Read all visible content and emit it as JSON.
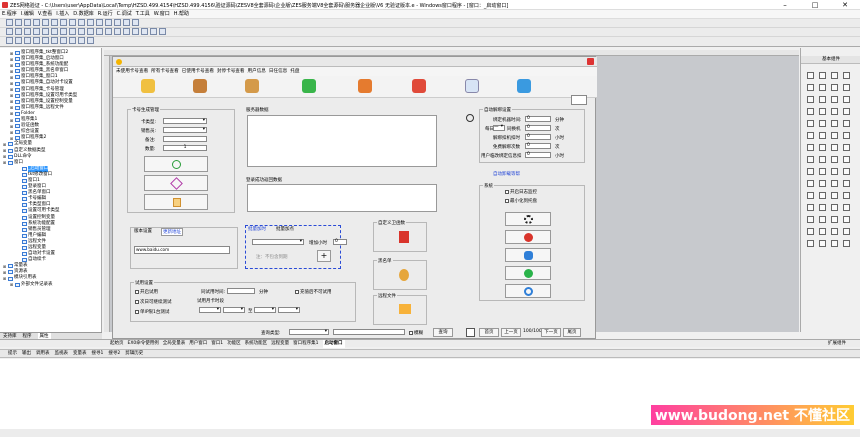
{
  "window": {
    "title": "ZES网络验证 - C:\\Users\\user\\AppData\\Local\\Temp\\HZSD.499.4154\\HZSD.499.4156\\验证源码\\ZESV8全套源码\\企业版\\ZES服务端V8全套源码\\服务器企业版\\V6 无验证版本.e - Windows窗口程序 - [窗口：_启动窗口]",
    "minimize": "–",
    "maximize": "□",
    "close": "✕"
  },
  "menubar": [
    "E.程序",
    "I.编辑",
    "V.查看",
    "I.插入",
    "D.数据库",
    "R.运行",
    "C.调试",
    "T.工具",
    "W.窗口",
    "H.帮助"
  ],
  "tree": {
    "items": [
      {
        "label": "窗口程序集_tkt整窗口2",
        "depth": 1,
        "icon": true
      },
      {
        "label": "窗口程序集_启动窗口",
        "depth": 1,
        "icon": true
      },
      {
        "label": "窗口程序集_系统功能配",
        "depth": 1,
        "icon": true
      },
      {
        "label": "窗口程序集_黑名单窗口",
        "depth": 1,
        "icon": true
      },
      {
        "label": "窗口程序集_窗口1",
        "depth": 1,
        "icon": true
      },
      {
        "label": "窗口程序集_自动对卡设置",
        "depth": 1,
        "icon": true
      },
      {
        "label": "窗口程序集_卡号管理",
        "depth": 1,
        "icon": true
      },
      {
        "label": "窗口程序集_设置可用卡类型",
        "depth": 1,
        "icon": true
      },
      {
        "label": "窗口程序集_设置控制变量",
        "depth": 1,
        "icon": true
      },
      {
        "label": "窗口程序集_远程文件",
        "depth": 1,
        "icon": true
      },
      {
        "label": "Folder",
        "depth": 1,
        "icon": true
      },
      {
        "label": "程序集1",
        "depth": 1,
        "icon": true
      },
      {
        "label": "验证函数",
        "depth": 1,
        "icon": true
      },
      {
        "label": "综合设置",
        "depth": 1,
        "icon": true
      },
      {
        "label": "窗口程序集2",
        "depth": 1,
        "icon": true
      },
      {
        "label": "全局变量",
        "depth": 0,
        "icon": true
      },
      {
        "label": "自定义数据类型",
        "depth": 0,
        "icon": true
      },
      {
        "label": "DLL命令",
        "depth": 0,
        "icon": true
      },
      {
        "label": "窗口",
        "depth": 0,
        "icon": true
      },
      {
        "label": "_启动窗口",
        "depth": 2,
        "icon": true,
        "selected": true
      },
      {
        "label": "tkt修改窗口",
        "depth": 2,
        "icon": true
      },
      {
        "label": "窗口1",
        "depth": 2,
        "icon": true
      },
      {
        "label": "登录窗口",
        "depth": 2,
        "icon": true
      },
      {
        "label": "黑名单窗口",
        "depth": 2,
        "icon": true
      },
      {
        "label": "卡号编辑",
        "depth": 2,
        "icon": true
      },
      {
        "label": "卡类型窗口",
        "depth": 2,
        "icon": true
      },
      {
        "label": "设置可用卡类型",
        "depth": 2,
        "icon": true
      },
      {
        "label": "设置控制变量",
        "depth": 2,
        "icon": true
      },
      {
        "label": "系统功能配置",
        "depth": 2,
        "icon": true
      },
      {
        "label": "销售员管理",
        "depth": 2,
        "icon": true
      },
      {
        "label": "用户编辑",
        "depth": 2,
        "icon": true
      },
      {
        "label": "远程文件",
        "depth": 2,
        "icon": true
      },
      {
        "label": "远程变量",
        "depth": 2,
        "icon": true
      },
      {
        "label": "自动对卡设置",
        "depth": 2,
        "icon": true
      },
      {
        "label": "自动续卡",
        "depth": 2,
        "icon": true
      },
      {
        "label": "常量表",
        "depth": 0,
        "icon": true
      },
      {
        "label": "资源表",
        "depth": 0,
        "icon": true
      },
      {
        "label": "模块引用表",
        "depth": 0,
        "icon": true
      },
      {
        "label": "外部文件记录表",
        "depth": 1,
        "icon": true
      }
    ]
  },
  "left_tabs": [
    "支持库",
    "程序",
    "属性"
  ],
  "form": {
    "menu": [
      "未使用卡号查看",
      "所有卡号查看",
      "已使用卡号查看",
      "封停卡号查看",
      "用户信息",
      "日任信息",
      "托盘"
    ],
    "card_gen": {
      "title": "卡号生成管理",
      "type_label": "卡类型:",
      "seller_label": "销售员:",
      "note_label": "备注:",
      "qty_label": "数量:",
      "qty_value": "1"
    },
    "server_data_title": "服务器数据",
    "verify_return_title": "登录成功返回数据",
    "auto_unbind": {
      "title": "自动解绑设置",
      "bind_time_label": "绑定机器时间:",
      "bind_time_value": "0",
      "bind_time_unit": "分钟",
      "per_day_label": "每日",
      "per_day_sel": "一",
      "same_machine_label": "同换机",
      "same_machine_value": "0",
      "same_machine_unit": "次",
      "unbind_deduct_label": "解绑扣机扣时",
      "unbind_deduct_value": "0",
      "unbind_deduct_unit": "小时",
      "free_unbind_label": "免费解绑次数",
      "free_unbind_value": "0",
      "free_unbind_unit": "次",
      "user_time_label": "用户临改绑定信息扣",
      "user_time_value": "0",
      "user_time_unit": "小时"
    },
    "auto_link": "自动卸载等帮",
    "system": {
      "title": "系统",
      "opt1": "开启日志监控",
      "opt2": "最小化到托盘"
    },
    "tabs": [
      "版本设置",
      "更新地址"
    ],
    "url_value": "www.baidu.com",
    "bulk_tabs": [
      "批量加时",
      "批量加点"
    ],
    "add_time_label": "增加小时",
    "add_time_value": "0",
    "bulk_note": "注：不包含到期",
    "bulk_add_btn": "+",
    "custom_rtl": "自定义卫函数",
    "blacklist": "黑名单",
    "remote_file": "远程文件",
    "trial": {
      "title": "试用设置",
      "opt1": "开启试用",
      "opt2": "次日可继续测试",
      "opt3": "单IP限1台测试",
      "same_time_label": "同试用时间:",
      "same_time_unit": "分钟",
      "no_retry": "充值后不可试用",
      "trial_count_label": "试用月卡时段",
      "to": "至"
    },
    "query": {
      "label": "查询类型:",
      "fuzzy": "模糊",
      "button": "查询"
    },
    "pager": {
      "first": "首页",
      "prev": "上一页",
      "page": "100/100",
      "next": "下一页",
      "last": "尾页"
    }
  },
  "right_panel": {
    "title": "基本组件"
  },
  "status_tabs": [
    "提示",
    "输出",
    "调用表",
    "监视表",
    "变量表",
    "搜寻1",
    "搜寻2",
    "剪辑历史"
  ],
  "form_tabs": [
    "起始页",
    "EX0命令使用例",
    "全局变量表",
    "用户窗口",
    "窗口1",
    "功能区",
    "系统功能区",
    "远程变量",
    "窗口程序集1",
    "启动窗口"
  ],
  "watermark": "www.budong.net 不懂社区",
  "expand_label": "扩展组件"
}
